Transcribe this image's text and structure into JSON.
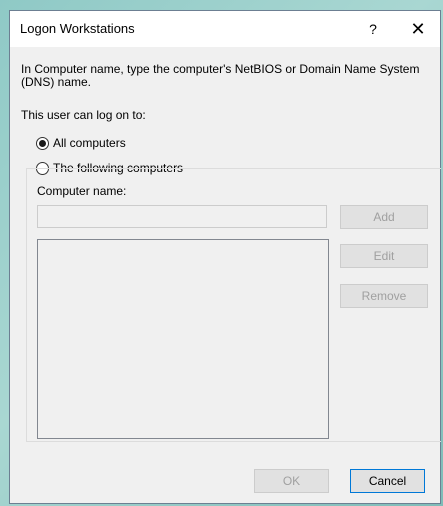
{
  "dialog": {
    "title": "Logon Workstations",
    "help_label": "?",
    "close_label": "✕"
  },
  "instructions": "In Computer name, type the computer's NetBIOS or Domain Name System (DNS) name.",
  "prompt": "This user can log on to:",
  "options": {
    "all_computers": {
      "label": "All computers",
      "selected": true
    },
    "following_computers": {
      "label": "The following computers",
      "selected": false
    }
  },
  "computer_name": {
    "label": "Computer name:",
    "value": ""
  },
  "buttons": {
    "add": "Add",
    "edit": "Edit",
    "remove": "Remove",
    "ok": "OK",
    "cancel": "Cancel"
  }
}
